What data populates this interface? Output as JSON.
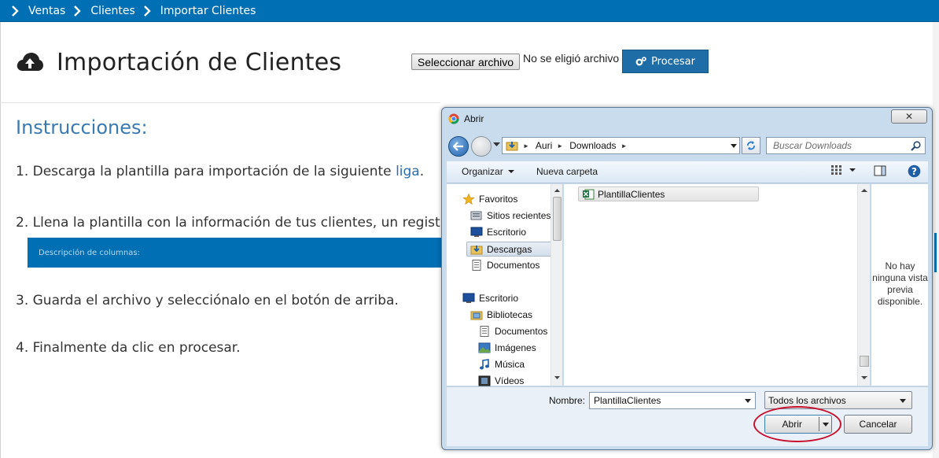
{
  "breadcrumb": {
    "items": [
      "Ventas",
      "Clientes",
      "Importar Clientes"
    ]
  },
  "page": {
    "title": "Importación de Clientes",
    "file_button": "Seleccionar archivo",
    "file_status": "No se eligió archivo",
    "process_button": "Procesar",
    "instructions_title": "Instrucciones:",
    "step1_text": "1. Descarga la plantilla para importación de la siguiente ",
    "step1_link": "liga",
    "step1_end": ".",
    "step2_text": "2. Llena la plantilla con la información de tus clientes, un registro p",
    "columns_bar": "Descripción de columnas:",
    "step3_text": "3. Guarda el archivo y selecciónalo en el botón de arriba.",
    "step4_text": "4. Finalmente da clic en procesar."
  },
  "dialog": {
    "title": "Abrir",
    "close_symbol": "✕",
    "path": [
      "Auri",
      "Downloads"
    ],
    "search_placeholder": "Buscar Downloads",
    "toolbar": {
      "organize": "Organizar",
      "new_folder": "Nueva carpeta"
    },
    "nav_items": [
      {
        "label": "Favoritos",
        "icon": "star-icon"
      },
      {
        "label": "Sitios recientes",
        "icon": "recent-places-icon"
      },
      {
        "label": "Escritorio",
        "icon": "desktop-icon"
      },
      {
        "label": "Descargas",
        "icon": "downloads-folder-icon",
        "selected": true
      },
      {
        "label": "Documentos",
        "icon": "documents-icon"
      },
      {
        "label": "Escritorio",
        "icon": "desktop-icon"
      },
      {
        "label": "Bibliotecas",
        "icon": "libraries-icon"
      },
      {
        "label": "Documentos",
        "icon": "documents-icon"
      },
      {
        "label": "Imágenes",
        "icon": "images-icon"
      },
      {
        "label": "Música",
        "icon": "music-icon"
      },
      {
        "label": "Vídeos",
        "icon": "videos-icon"
      }
    ],
    "files": [
      {
        "name": "PlantillaClientes",
        "icon": "excel-file-icon"
      }
    ],
    "preview_text": "No hay ninguna vista previa disponible.",
    "filename_label": "Nombre:",
    "filename_value": "PlantillaClientes",
    "file_type": "Todos los archivos",
    "open_button": "Abrir",
    "cancel_button": "Cancelar"
  },
  "colors": {
    "brand_blue": "#006fb3",
    "link_blue": "#2a6fb0",
    "highlight_red": "#c8102e",
    "dialog_chrome": "#c9dced"
  }
}
